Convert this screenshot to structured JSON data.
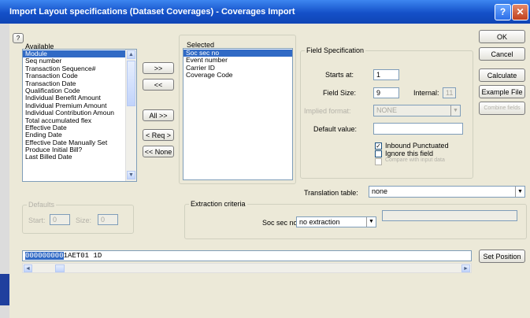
{
  "window": {
    "title": "Import Layout specifications (Dataset Coverages) - Coverages Import",
    "help_glyph": "?",
    "close_glyph": "✕"
  },
  "context_help_glyph": "?",
  "available": {
    "label": "Available",
    "items": [
      "Module",
      "Seq number",
      "Transaction Sequence#",
      "Transaction Code",
      "Transaction Date",
      "Qualification Code",
      "Individual Benefit Amount",
      "Individual Premium Amount",
      "Individual Contribution Amoun",
      "Total accumulated flex",
      "Effective Date",
      "Ending Date",
      "Effective Date Manually Set",
      "Produce Initial Bill?",
      "Last Billed Date"
    ],
    "selected_index": 0
  },
  "mid_buttons": {
    "add": ">>",
    "remove": "<<",
    "all": "All >>",
    "req": "< Req >",
    "none": "<< None"
  },
  "selected": {
    "label": "Selected",
    "items": [
      "Soc sec no",
      "Event number",
      "Carrier ID",
      "Coverage Code"
    ],
    "selected_index": 0
  },
  "field_spec": {
    "title": "Field Specification",
    "starts_at_label": "Starts at:",
    "starts_at_value": "1",
    "field_size_label": "Field Size:",
    "field_size_value": "9",
    "internal_label": "Internal:",
    "internal_value": "11",
    "implied_format_label": "Implied format:",
    "implied_format_value": "NONE",
    "default_value_label": "Default value:",
    "default_value": "",
    "checks": [
      {
        "label": "Inbound Punctuated",
        "checked": true,
        "disabled": false
      },
      {
        "label": "Ignore this field",
        "checked": false,
        "disabled": false
      },
      {
        "label": "Compare with input data",
        "checked": false,
        "disabled": true
      }
    ]
  },
  "right_buttons": {
    "ok": "OK",
    "cancel": "Cancel",
    "calculate": "Calculate",
    "example_file": "Example File",
    "combine_fields": "Combine fields"
  },
  "translation": {
    "label": "Translation table:",
    "value": "none"
  },
  "defaults_group": {
    "title": "Defaults",
    "start_label": "Start:",
    "start_value": "0",
    "size_label": "Size:",
    "size_value": "0"
  },
  "extraction": {
    "title": "Extraction criteria",
    "field_label": "Soc sec no:",
    "value": "no extraction",
    "extra_value": ""
  },
  "sample": {
    "highlight": "000000000",
    "rest": "1AET01  1D"
  },
  "set_position": "Set Position",
  "scroll_glyphs": {
    "up": "▲",
    "down": "▼",
    "left": "◄",
    "right": "►"
  }
}
